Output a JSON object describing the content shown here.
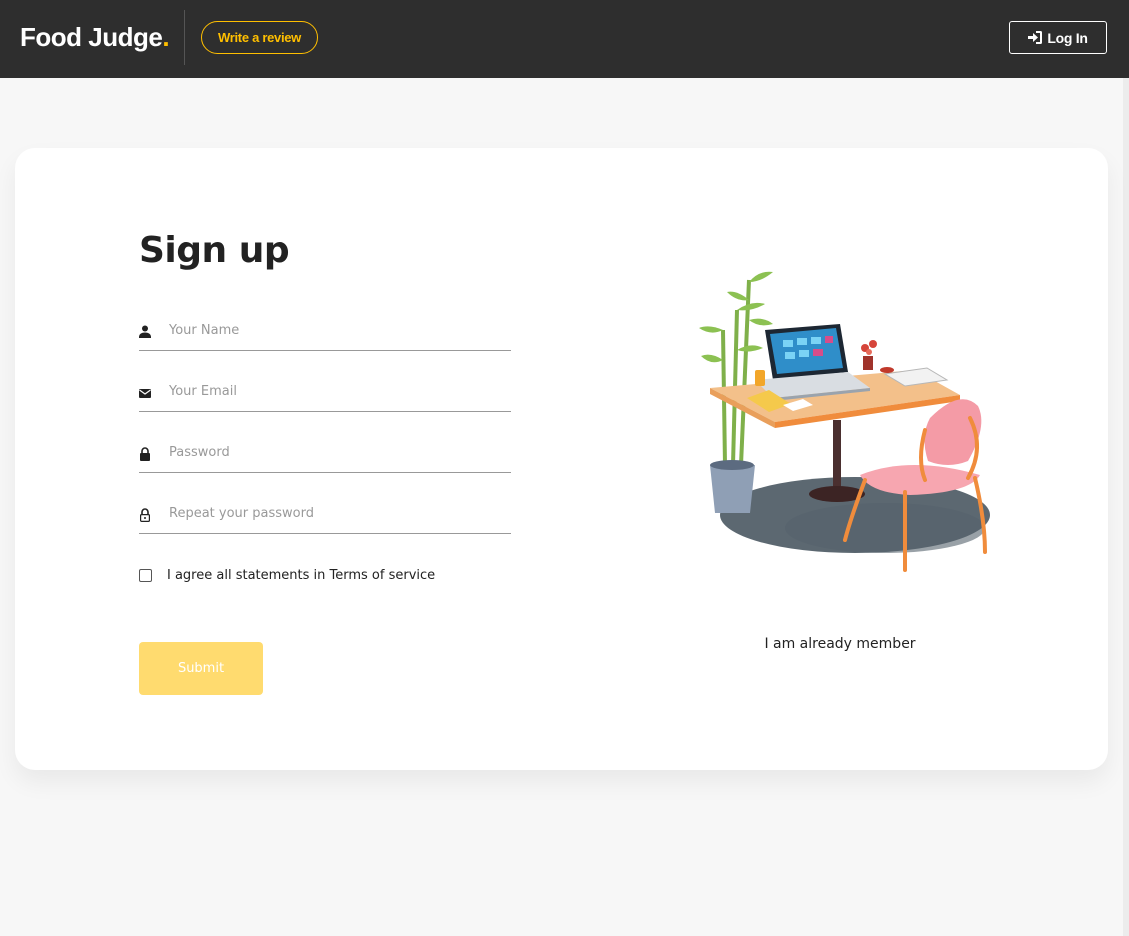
{
  "header": {
    "brand": "Food Judge",
    "brand_dot": ".",
    "write_review": "Write a review",
    "login": "Log In"
  },
  "signup": {
    "title": "Sign up",
    "name_placeholder": "Your Name",
    "email_placeholder": "Your Email",
    "password_placeholder": "Password",
    "repeat_placeholder": "Repeat your password",
    "agree_text": "I agree all statements in Terms of service",
    "submit": "Submit",
    "already_member": "I am already member"
  },
  "colors": {
    "accent": "#ffbf00",
    "submit_bg": "#ffdb6f",
    "topbar": "#2e2e2e"
  },
  "icons": {
    "login": "sign-in-icon",
    "name": "person-icon",
    "email": "envelope-icon",
    "password": "lock-icon",
    "repeat": "lock-outline-icon"
  }
}
